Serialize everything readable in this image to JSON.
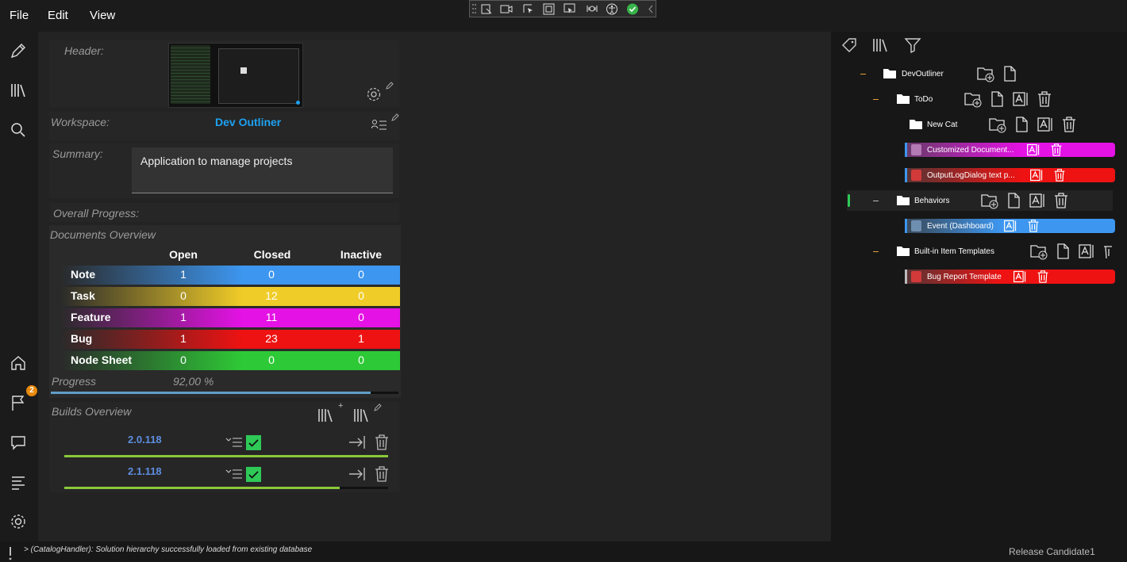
{
  "menu": {
    "file": "File",
    "edit": "Edit",
    "view": "View"
  },
  "project": {
    "header_label": "Header:",
    "workspace_label": "Workspace:",
    "workspace_name": "Dev Outliner",
    "summary_label": "Summary:",
    "summary_value": "Application to manage projects",
    "overall_progress_label": "Overall Progress:"
  },
  "documents": {
    "title": "Documents Overview",
    "headers": [
      "Open",
      "Closed",
      "Inactive"
    ],
    "rows": [
      {
        "name": "Note",
        "open": "1",
        "closed": "0",
        "inactive": "0",
        "color": "#3d96ef"
      },
      {
        "name": "Task",
        "open": "0",
        "closed": "12",
        "inactive": "0",
        "color": "#f0cc28"
      },
      {
        "name": "Feature",
        "open": "1",
        "closed": "11",
        "inactive": "0",
        "color": "#e412e4"
      },
      {
        "name": "Bug",
        "open": "1",
        "closed": "23",
        "inactive": "1",
        "color": "#ee1212"
      },
      {
        "name": "Node Sheet",
        "open": "0",
        "closed": "0",
        "inactive": "0",
        "color": "#2ec936"
      }
    ],
    "progress_label": "Progress",
    "progress_value": "92,00 %",
    "progress_fraction": 0.92
  },
  "builds": {
    "title": "Builds Overview",
    "items": [
      {
        "version": "2.0.118",
        "progress": 1.0
      },
      {
        "version": "2.1.118",
        "progress": 0.85
      }
    ]
  },
  "badge_count": "2",
  "tree": {
    "root": "DevOutliner",
    "todo": "ToDo",
    "new_cat": "New Cat",
    "doc1": "Customized Document...",
    "doc2": "OutputLogDialog text p...",
    "behaviors": "Behaviors",
    "event": "Event (Dashboard)",
    "templates": "Built-in Item Templates",
    "bug_template": "Bug Report Template"
  },
  "status": {
    "log": "> (CatalogHandler): Solution hierarchy successfully loaded from existing database",
    "release": "Release Candidate1"
  },
  "colors": {
    "accent_blue": "#1da1f2",
    "build_blue": "#5e8ee0",
    "green_check": "#2ec957",
    "progress_bar": "#5e9ec7"
  }
}
